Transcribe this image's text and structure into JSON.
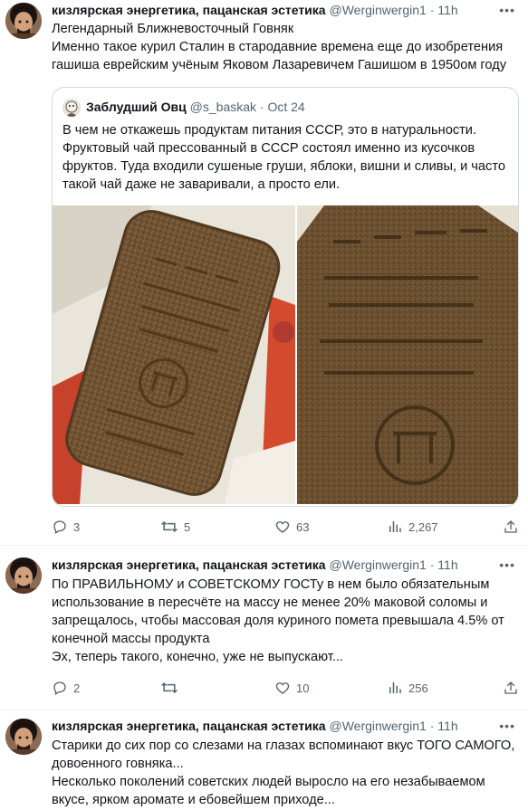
{
  "tweets": [
    {
      "author_name": "кизлярская энергетика, пацанская эстетика",
      "handle": "@Werginwergin1",
      "sep": "·",
      "time": "11h",
      "text": [
        "Легендарный Ближневосточный Говняк",
        "Именно такое курил Сталин в стародавние времена еще до изобретения гашиша еврейским учёным Яковом Лазаревичем Гашишом в 1950ом году"
      ],
      "quote": {
        "author_name": "Заблудший Овц",
        "handle": "@s_baskak",
        "sep": "·",
        "date": "Oct 24",
        "text": "В чем не откажешь продуктам питания СССР, это в натуральности. Фруктовый чай прессованный в СССР состоял именно из кусочков фруктов. Туда входили сушеные груши, яблоки, вишни и сливы, и часто такой чай даже не заваривали, а просто ели.",
        "images": [
          "photo-tea-brick-1",
          "photo-tea-brick-2"
        ]
      },
      "stats": {
        "replies": "3",
        "retweets": "5",
        "likes": "63",
        "views": "2,267"
      }
    },
    {
      "author_name": "кизлярская энергетика, пацанская эстетика",
      "handle": "@Werginwergin1",
      "sep": "·",
      "time": "11h",
      "text": [
        "По ПРАВИЛЬНОМУ и СОВЕТСКОМУ ГОСТу в нем было обязательным использование в пересчёте на массу не менее 20% маковой соломы и запрещалось, чтобы массовая доля куриного помета превышала 4.5% от конечной массы продукта",
        "Эх, теперь такого, конечно, уже не выпускают..."
      ],
      "stats": {
        "replies": "2",
        "retweets": "",
        "likes": "10",
        "views": "256"
      }
    },
    {
      "author_name": "кизлярская энергетика, пацанская эстетика",
      "handle": "@Werginwergin1",
      "sep": "·",
      "time": "11h",
      "text": [
        "Старики до сих пор со слезами на глазах вспоминают вкус ТОГО САМОГО, довоенного говняка...",
        "Несколько поколений советских людей выросло на его незабываемом вкусе, ярком аромате и ебовейшем приходе..."
      ]
    }
  ],
  "icons": {
    "more": "more-icon",
    "reply": "reply-icon",
    "retweet": "retweet-icon",
    "like": "like-icon",
    "views": "views-icon",
    "share": "share-icon"
  },
  "colors": {
    "text": "#0f1419",
    "muted": "#536471",
    "border": "#cfd9de"
  }
}
